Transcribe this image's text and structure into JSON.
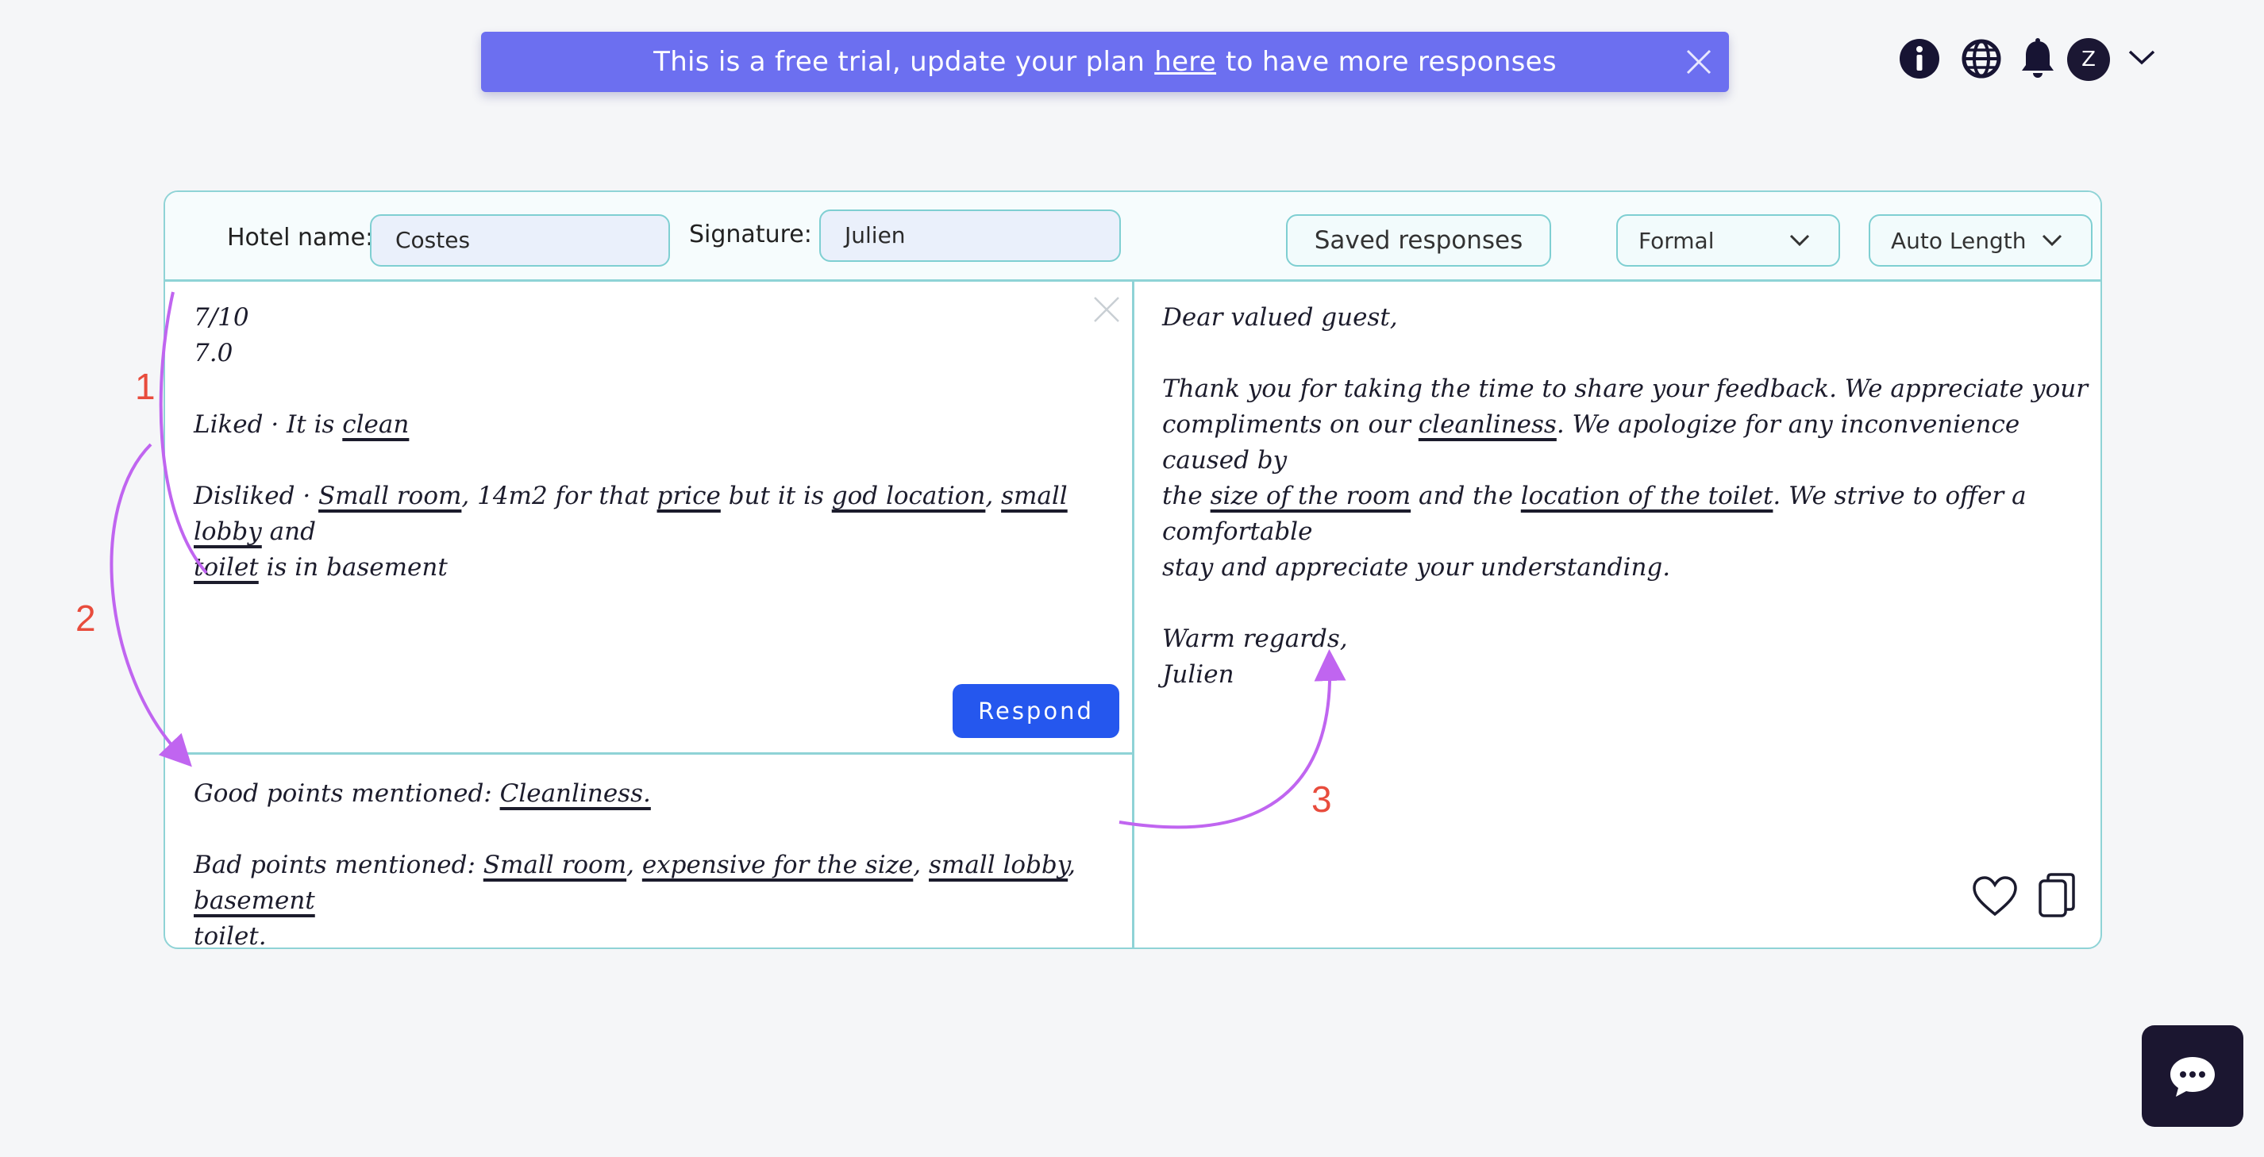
{
  "banner": {
    "text_before": "This is a free trial, update your plan",
    "link": "here",
    "text_after": "to have more responses"
  },
  "topbar": {
    "icons": [
      "info-icon",
      "globe-icon",
      "bell-icon"
    ],
    "avatar_letter": "Z"
  },
  "toolbar": {
    "hotel_label": "Hotel name:",
    "hotel_value": "Costes",
    "signature_label": "Signature:",
    "signature_value": "Julien",
    "saved_responses": "Saved responses",
    "tone": "Formal",
    "length": "Auto Length"
  },
  "review": {
    "score1": "7/10",
    "score2": "7.0",
    "liked_prefix": "Liked · It is ",
    "liked_word": "clean",
    "disliked_prefix": "Disliked · ",
    "d1": "Small room",
    "d2": ", 14m2 for that ",
    "d3": "price",
    "d4": " but it is ",
    "d5": "god location",
    "d6": ", ",
    "d7": "small lobby",
    "d8": " and",
    "d9": "toilet",
    "d10": " is in basement",
    "respond": "Respond"
  },
  "analysis": {
    "good_prefix": "Good points mentioned: ",
    "good1": "Cleanliness.",
    "bad_prefix": "Bad points mentioned: ",
    "bad1": "Small room",
    "sep": ", ",
    "bad2": "expensive for the size",
    "bad3": "small lobby",
    "bad4": "basement",
    "bad5": "toilet",
    "end": "."
  },
  "reply": {
    "greeting": "Dear valued guest,",
    "r1": "Thank you for taking the time to share your feedback. We appreciate your",
    "r2a": "compliments on our ",
    "r2b": "cleanliness",
    "r2c": ". We apologize for any inconvenience caused by",
    "r3a": "the ",
    "r3b": "size of the room",
    "r3c": " and the ",
    "r3d": "location of the toilet",
    "r3e": ". We strive to offer a comfortable",
    "r4": "stay and appreciate your understanding.",
    "closing": "Warm regards,",
    "name": "Julien"
  },
  "annotations": [
    "1",
    "2",
    "3"
  ],
  "colors": {
    "banner": "#6c6ff0",
    "accent_border": "#8fd3d6",
    "respond_button": "#2557ee",
    "annotation_arrow": "#c065f0",
    "annotation_number": "#e84c3d"
  }
}
